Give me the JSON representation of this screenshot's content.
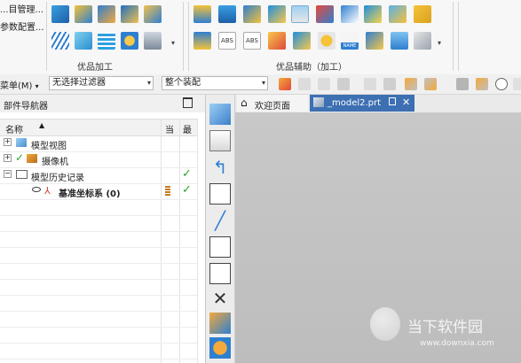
{
  "ribbon": {
    "menu_items": [
      "...目管理...",
      "参数配置..."
    ],
    "group1_label": "优品加工",
    "group2_label": "优品辅助（加工）",
    "icon_labels": [
      "ABS",
      "ABS",
      "NAME"
    ]
  },
  "filter_bar": {
    "menu_label": "菜单(M)",
    "filter_value": "无选择过滤器",
    "assembly_value": "整个装配"
  },
  "navigator": {
    "title": "部件导航器",
    "col_name": "名称",
    "col_current": "当",
    "col_latest": "最",
    "items": [
      {
        "label": "模型视图"
      },
      {
        "label": "摄像机"
      },
      {
        "label": "模型历史记录"
      },
      {
        "label": "基准坐标系 (0)"
      }
    ]
  },
  "tabs": {
    "welcome": "欢迎页面",
    "model": "_model2.prt"
  },
  "watermark": {
    "title": "当下软件园",
    "url": "www.downxia.com"
  },
  "colors": {
    "accent_blue": "#2f7fd0",
    "check_green": "#2fa52f",
    "tab_active": "#3d6fb3"
  }
}
